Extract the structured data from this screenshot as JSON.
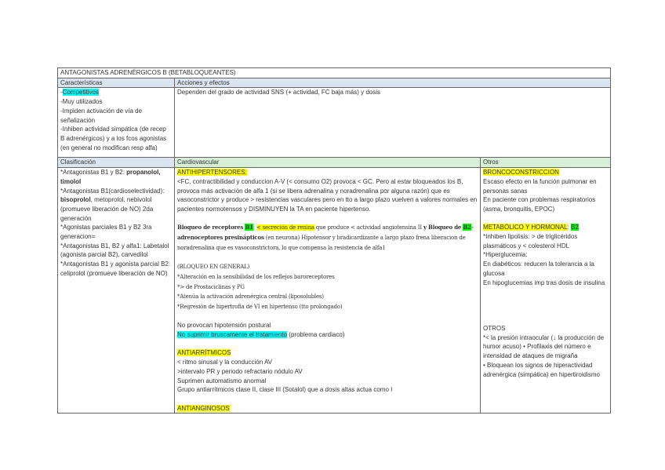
{
  "title": "ANTAGONISTAS ADRENÉRGICOS B (BETABLOQUEANTES)",
  "headers1": {
    "caracteristicas": "Características",
    "acciones": "Acciones y efectos"
  },
  "headers2": {
    "clasificacion": "Clasificación",
    "cardiovascular": "Cardiovascular",
    "otros": "Otros"
  },
  "cells": {
    "caracteristicas": [
      [
        {
          "t": "-"
        },
        {
          "t": "Competitivos",
          "hl": "c"
        }
      ],
      [
        {
          "t": "-Muy utilizados"
        }
      ],
      [
        {
          "t": "-Impiden activación de vía de señalización"
        }
      ],
      [
        {
          "t": "-Inhiben actividad simpática (de recep B adrenérgicos) y a los fcos agonistas (en general no modifican resp alfa)"
        }
      ]
    ],
    "acciones": [
      [
        {
          "t": "Dependen del grado de actividad SNS (+ actividad, FC baja más) y dosis"
        }
      ]
    ],
    "clasificacion": [
      [
        {
          "t": "*Antagonistas B1 y B2: "
        },
        {
          "t": "propanolol, timolol",
          "b": true
        }
      ],
      [
        {
          "t": "*Antagonistas B1(cardioselectividad): "
        },
        {
          "t": "bisoprolol",
          "b": true
        },
        {
          "t": ", metoprolol, nebivolol (promueve liberación de NO) 2da generación"
        }
      ],
      [
        {
          "t": "*Agonistas parciales B1 y B2 3ra generacion="
        }
      ],
      [
        {
          "t": "*Antagonistas B1, B2 y alfa1: Labetalol (agonista parcial B2), carvedilol"
        }
      ],
      [
        {
          "t": "*Antagonistas B1 y agonista parcial B2: celiprolol (promueve liberación de NO)"
        }
      ]
    ],
    "cardiovascular": [
      [
        {
          "t": "ANTIHIPERTENSORES:",
          "hl": "y"
        }
      ],
      [
        {
          "t": "<FC, contractibilidad y conduccion A-V (< consumo O2) provoca < GC. Pero al estar bloqueados los B, provoca más activación de alfa 1 (si se libera adrenalina y noradrenalina por alguna razón) que es vasoconstrictor y produce > resistencias vasculares pero en tto a largo plazo vuelven a valores normales en pacientes normotensos y DISMINUYEN la TA en paciente hipertenso."
        }
      ],
      [],
      [
        {
          "t": "Bloqueo de receptores ",
          "b": true,
          "s": true
        },
        {
          "t": "B1",
          "b": true,
          "s": true,
          "hl": "g"
        },
        {
          "t": ": ",
          "s": true
        },
        {
          "t": "< secreción de renina",
          "s": true,
          "hl": "y"
        },
        {
          "t": " que produce < actividad angiotensina II ",
          "s": true
        },
        {
          "t": "y Bloqueo de ",
          "b": true,
          "s": true
        },
        {
          "t": "B2",
          "b": true,
          "s": true,
          "hl": "g"
        },
        {
          "t": "-adrenoceptores presinápticos",
          "b": true,
          "s": true
        },
        {
          "t": " (en neurona) Hipotensor y bradicardizante a largo plazo frena liberacion de noradrenalina que es vasoconstrictora, lo que compensa la resistencia de alfa1",
          "s": true
        }
      ],
      [],
      [
        {
          "t": "(BLOQUEO EN GENERAL)",
          "s": true
        }
      ],
      [
        {
          "t": "*Alteración en la sensibilidad de los reflejos baroreceptores",
          "s": true
        }
      ],
      [
        {
          "t": "*> de Prostaciclinas y PG",
          "s": true
        }
      ],
      [
        {
          "t": "*Atenúa la activación adrenérgica central (liposolubles)",
          "s": true
        }
      ],
      [
        {
          "t": "*Regresión de hipertrofia de VI en hipertenso (tto prolongado)",
          "s": true
        }
      ],
      [],
      [
        {
          "t": "No provocan hipotensión postural"
        }
      ],
      [
        {
          "t": "No suprimir bruscamente el tratamiento",
          "hl": "c"
        },
        {
          "t": " (problema cardiaco)"
        }
      ],
      [],
      [
        {
          "t": "ANTIARRÍTMICOS",
          "hl": "y"
        }
      ],
      [
        {
          "t": "< ritmo sinusal y la conducción AV"
        }
      ],
      [
        {
          "t": ">intervalo PR y periodo refractario nódulo AV"
        }
      ],
      [
        {
          "t": "Suprimen automatismo anormal"
        }
      ],
      [
        {
          "t": "Grupo antiarrítmicos clase II, clase III (Sotalol) que a dosis altas actua como I"
        }
      ],
      [],
      [
        {
          "t": "ANTIANGINOSOS",
          "hl": "y"
        }
      ]
    ],
    "otros": [
      [
        {
          "t": "BRONCOCONSTRICCION",
          "hl": "y"
        }
      ],
      [
        {
          "t": "Escaso efecto en la función pulmonar en personas sanas"
        }
      ],
      [
        {
          "t": "En paciente con problemas respiratorios (asma, bronquitis, EPOC)"
        }
      ],
      [],
      [
        {
          "t": "METABÓLICO Y HORMONAL",
          "hl": "y"
        },
        {
          "t": ": "
        },
        {
          "t": "B2",
          "hl": "g"
        }
      ],
      [
        {
          "t": "*Inhiben lipolisis: > de triglicéridos plasmáticos y < colesterol HDL"
        }
      ],
      [
        {
          "t": " *Hiperglucemia:"
        }
      ],
      [
        {
          "t": "En diabéticos: reducen la tolerancia a la glucosa"
        }
      ],
      [
        {
          "t": "En hipoglucemias imp tras dosis de insulina"
        }
      ],
      [],
      [],
      [],
      [],
      [
        {
          "t": "OTROS"
        }
      ],
      [
        {
          "t": "*< la presión intraocular (↓ la producción de humor acuso) • Profilaxis del número e intensidad de ataques de migraña"
        }
      ],
      [
        {
          "t": "• Bloquean los signos de hiperactividad adrenérgica (simpática) en hipertiroidismo"
        }
      ]
    ]
  }
}
